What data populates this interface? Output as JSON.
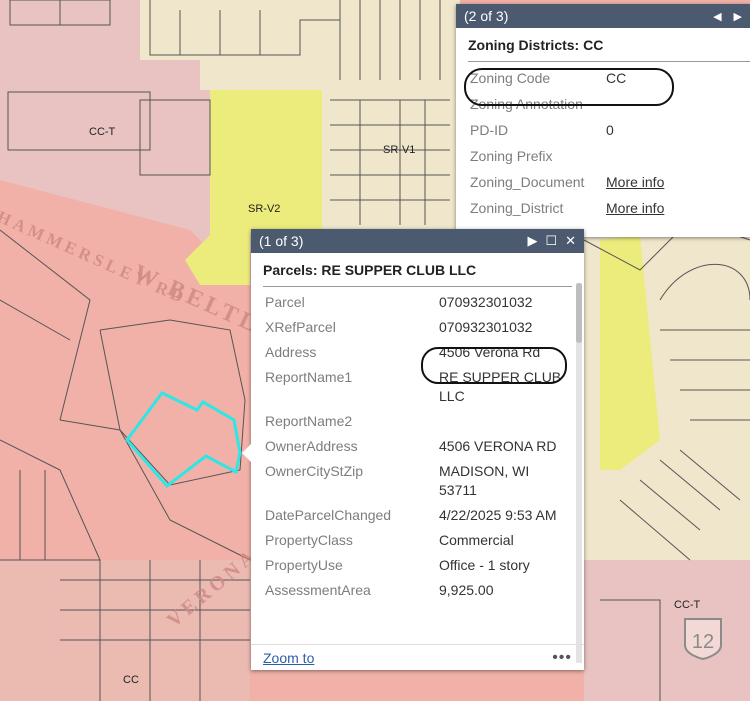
{
  "map": {
    "zone_labels": {
      "cct_left": "CC-T",
      "srv1": "SR-V1",
      "srv2": "SR-V2",
      "cc_bottom": "CC",
      "cct_right": "CC-T",
      "cc_hidden": "CC-"
    },
    "roads": {
      "hammersley": "HAMMERSLEY RD",
      "beltline": "W BELTL",
      "verona": "VERONA RD"
    },
    "highway_shield": "12",
    "colors": {
      "commercial": "#f2b1a8",
      "commercial_light": "#e7c4c2",
      "residential": "#f4efb0",
      "yellow_zone": "#f0ef80",
      "parcel_outline": "#555555",
      "selected_parcel": "#2de6e6"
    }
  },
  "zoning_popup": {
    "counter": "(2 of 3)",
    "title": "Zoning Districts: CC",
    "fields": [
      {
        "key": "Zoning Code",
        "value": "CC"
      },
      {
        "key": "Zoning Annotation",
        "value": ""
      },
      {
        "key": "PD-ID",
        "value": "0"
      },
      {
        "key": "Zoning Prefix",
        "value": ""
      },
      {
        "key": "Zoning_Document",
        "value": "More info",
        "link": true
      },
      {
        "key": "Zoning_District",
        "value": "More info",
        "link": true
      }
    ]
  },
  "parcel_popup": {
    "counter": "(1 of 3)",
    "title": "Parcels: RE SUPPER CLUB LLC",
    "fields": [
      {
        "key": "Parcel",
        "value": "070932301032"
      },
      {
        "key": "XRefParcel",
        "value": "070932301032"
      },
      {
        "key": "Address",
        "value": "4506 Verona Rd"
      },
      {
        "key": "ReportName1",
        "value": "RE SUPPER CLUB LLC"
      },
      {
        "key": "ReportName2",
        "value": ""
      },
      {
        "key": "OwnerAddress",
        "value": "4506 VERONA RD"
      },
      {
        "key": "OwnerCityStZip",
        "value": "MADISON, WI 53711"
      },
      {
        "key": "DateParcelChanged",
        "value": "4/22/2025 9:53 AM"
      },
      {
        "key": "PropertyClass",
        "value": "Commercial"
      },
      {
        "key": "PropertyUse",
        "value": "Office - 1 story"
      },
      {
        "key": "AssessmentArea",
        "value": "9,925.00"
      }
    ],
    "zoom_link": "Zoom to",
    "more": "•••"
  }
}
